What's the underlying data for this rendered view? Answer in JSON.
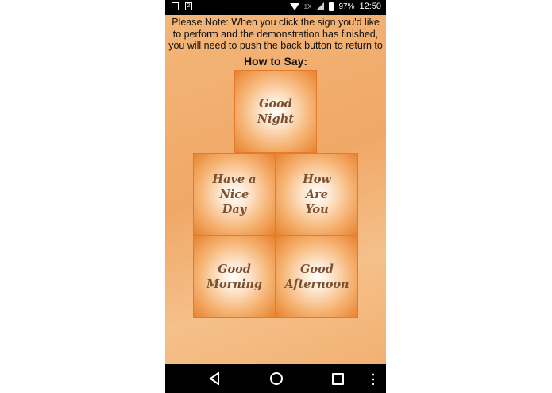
{
  "status_bar": {
    "network_label": "1X",
    "battery": "97%",
    "time": "12:50",
    "icons": [
      "image-icon",
      "sim-icon",
      "wifi-icon",
      "signal-icon",
      "battery-icon"
    ]
  },
  "note": "Please Note: When you click the sign you'd like to perform and the demonstration has finished, you will need to push the back button to return to our",
  "heading": "How to Say:",
  "tiles": [
    {
      "label": "Good\nNight"
    },
    {
      "label": "Have a\nNice\nDay"
    },
    {
      "label": "How\nAre\nYou"
    },
    {
      "label": "Good\nMorning"
    },
    {
      "label": "Good\nAfternoon"
    }
  ],
  "nav": {
    "icons": [
      "back-icon",
      "home-icon",
      "recents-icon",
      "menu-icon"
    ]
  },
  "colors": {
    "background": "#f0a867",
    "tile_edge": "#e57a2a",
    "tile_text": "#7a5030"
  }
}
